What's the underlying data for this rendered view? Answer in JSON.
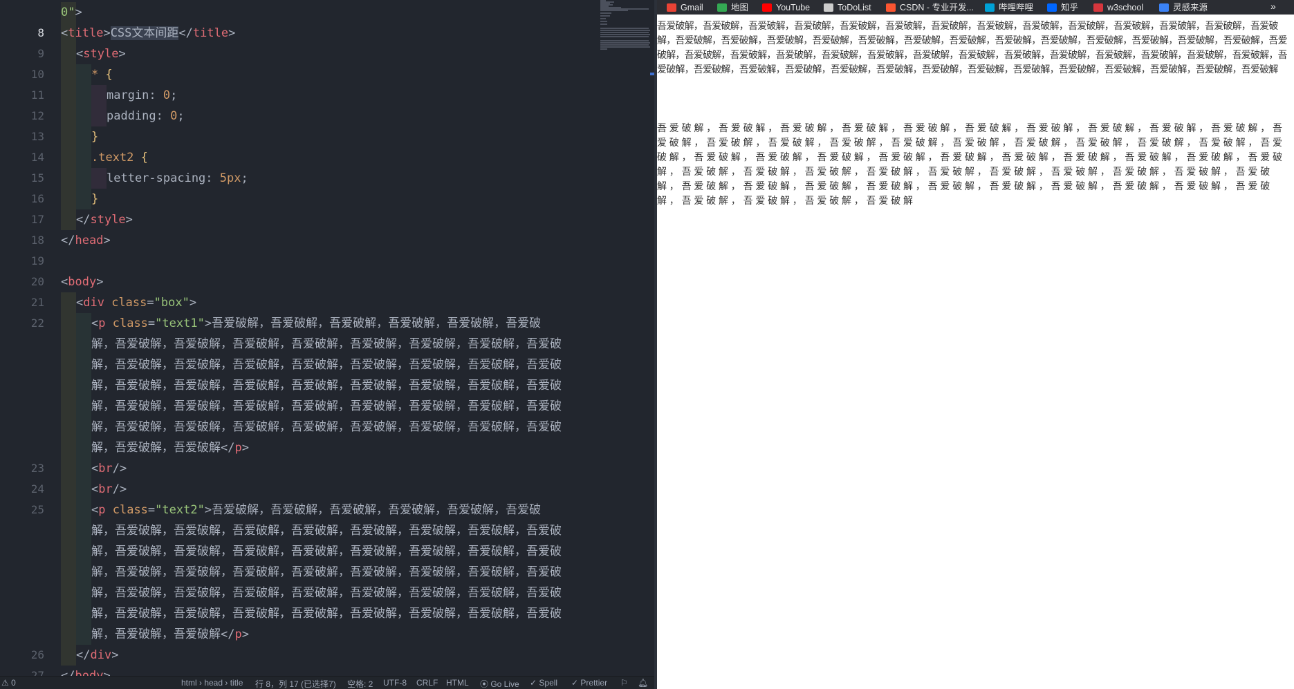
{
  "editor": {
    "lines": [
      {
        "num": "",
        "tokens": [
          [
            "str",
            "0\""
          ],
          [
            "br",
            ">"
          ]
        ]
      },
      {
        "num": "8",
        "active": true,
        "tokens": [
          [
            "br",
            "<"
          ],
          [
            "tag",
            "title"
          ],
          [
            "br",
            ">"
          ],
          [
            "hl",
            "CSS文本间距"
          ],
          [
            "br",
            "</"
          ],
          [
            "tag",
            "title"
          ],
          [
            "br",
            ">"
          ]
        ]
      },
      {
        "num": "9",
        "tokens": [
          [
            "br",
            "<"
          ],
          [
            "tag",
            "style"
          ],
          [
            "br",
            ">"
          ]
        ]
      },
      {
        "num": "10",
        "tokens": [
          [
            "sel",
            "* "
          ],
          [
            "brace",
            "{"
          ]
        ]
      },
      {
        "num": "11",
        "tokens": [
          [
            "prop",
            "margin: "
          ],
          [
            "num",
            "0"
          ],
          [
            "prop",
            ";"
          ]
        ]
      },
      {
        "num": "12",
        "tokens": [
          [
            "prop",
            "padding: "
          ],
          [
            "num",
            "0"
          ],
          [
            "prop",
            ";"
          ]
        ]
      },
      {
        "num": "13",
        "tokens": [
          [
            "brace",
            "}"
          ]
        ]
      },
      {
        "num": "14",
        "tokens": [
          [
            "sel",
            ".text2 "
          ],
          [
            "brace",
            "{"
          ]
        ]
      },
      {
        "num": "15",
        "tokens": [
          [
            "prop",
            "letter-spacing: "
          ],
          [
            "num",
            "5px"
          ],
          [
            "prop",
            ";"
          ]
        ]
      },
      {
        "num": "16",
        "tokens": [
          [
            "brace",
            "}"
          ]
        ]
      },
      {
        "num": "17",
        "tokens": [
          [
            "br",
            "</"
          ],
          [
            "tag",
            "style"
          ],
          [
            "br",
            ">"
          ]
        ]
      },
      {
        "num": "18",
        "tokens": [
          [
            "br",
            "</"
          ],
          [
            "tag",
            "head"
          ],
          [
            "br",
            ">"
          ]
        ]
      },
      {
        "num": "19",
        "tokens": []
      },
      {
        "num": "20",
        "tokens": [
          [
            "br",
            "<"
          ],
          [
            "tag",
            "body"
          ],
          [
            "br",
            ">"
          ]
        ]
      },
      {
        "num": "21",
        "tokens": [
          [
            "br",
            "<"
          ],
          [
            "tag",
            "div "
          ],
          [
            "attr",
            "class"
          ],
          [
            "br",
            "="
          ],
          [
            "str",
            "\"box\""
          ],
          [
            "br",
            ">"
          ]
        ]
      },
      {
        "num": "22",
        "tokens": [
          [
            "br",
            "<"
          ],
          [
            "tag",
            "p "
          ],
          [
            "attr",
            "class"
          ],
          [
            "br",
            "="
          ],
          [
            "str",
            "\"text1\""
          ],
          [
            "br",
            ">"
          ],
          [
            "text",
            "吾爱破解，吾爱破解，吾爱破解，吾爱破解，吾爱破解，吾爱破"
          ]
        ]
      },
      {
        "num": "",
        "tokens": [
          [
            "text",
            "解，吾爱破解，吾爱破解，吾爱破解，吾爱破解，吾爱破解，吾爱破解，吾爱破解，吾爱破"
          ]
        ]
      },
      {
        "num": "",
        "tokens": [
          [
            "text",
            "解，吾爱破解，吾爱破解，吾爱破解，吾爱破解，吾爱破解，吾爱破解，吾爱破解，吾爱破"
          ]
        ]
      },
      {
        "num": "",
        "tokens": [
          [
            "text",
            "解，吾爱破解，吾爱破解，吾爱破解，吾爱破解，吾爱破解，吾爱破解，吾爱破解，吾爱破"
          ]
        ]
      },
      {
        "num": "",
        "tokens": [
          [
            "text",
            "解，吾爱破解，吾爱破解，吾爱破解，吾爱破解，吾爱破解，吾爱破解，吾爱破解，吾爱破"
          ]
        ]
      },
      {
        "num": "",
        "tokens": [
          [
            "text",
            "解，吾爱破解，吾爱破解，吾爱破解，吾爱破解，吾爱破解，吾爱破解，吾爱破解，吾爱破"
          ]
        ]
      },
      {
        "num": "",
        "tokens": [
          [
            "text",
            "解，吾爱破解，吾爱破解"
          ],
          [
            "br",
            "</"
          ],
          [
            "tag",
            "p"
          ],
          [
            "br",
            ">"
          ]
        ]
      },
      {
        "num": "23",
        "tokens": [
          [
            "br",
            "<"
          ],
          [
            "tag",
            "br"
          ],
          [
            "br",
            "/>"
          ]
        ]
      },
      {
        "num": "24",
        "tokens": [
          [
            "br",
            "<"
          ],
          [
            "tag",
            "br"
          ],
          [
            "br",
            "/>"
          ]
        ]
      },
      {
        "num": "25",
        "tokens": [
          [
            "br",
            "<"
          ],
          [
            "tag",
            "p "
          ],
          [
            "attr",
            "class"
          ],
          [
            "br",
            "="
          ],
          [
            "str",
            "\"text2\""
          ],
          [
            "br",
            ">"
          ],
          [
            "text",
            "吾爱破解，吾爱破解，吾爱破解，吾爱破解，吾爱破解，吾爱破"
          ]
        ]
      },
      {
        "num": "",
        "tokens": [
          [
            "text",
            "解，吾爱破解，吾爱破解，吾爱破解，吾爱破解，吾爱破解，吾爱破解，吾爱破解，吾爱破"
          ]
        ]
      },
      {
        "num": "",
        "tokens": [
          [
            "text",
            "解，吾爱破解，吾爱破解，吾爱破解，吾爱破解，吾爱破解，吾爱破解，吾爱破解，吾爱破"
          ]
        ]
      },
      {
        "num": "",
        "tokens": [
          [
            "text",
            "解，吾爱破解，吾爱破解，吾爱破解，吾爱破解，吾爱破解，吾爱破解，吾爱破解，吾爱破"
          ]
        ]
      },
      {
        "num": "",
        "tokens": [
          [
            "text",
            "解，吾爱破解，吾爱破解，吾爱破解，吾爱破解，吾爱破解，吾爱破解，吾爱破解，吾爱破"
          ]
        ]
      },
      {
        "num": "",
        "tokens": [
          [
            "text",
            "解，吾爱破解，吾爱破解，吾爱破解，吾爱破解，吾爱破解，吾爱破解，吾爱破解，吾爱破"
          ]
        ]
      },
      {
        "num": "",
        "tokens": [
          [
            "text",
            "解，吾爱破解，吾爱破解"
          ],
          [
            "br",
            "</"
          ],
          [
            "tag",
            "p"
          ],
          [
            "br",
            ">"
          ]
        ]
      },
      {
        "num": "26",
        "tokens": [
          [
            "br",
            "</"
          ],
          [
            "tag",
            "div"
          ],
          [
            "br",
            ">"
          ]
        ]
      },
      {
        "num": "27",
        "tokens": [
          [
            "br",
            "</"
          ],
          [
            "tag",
            "body"
          ],
          [
            "br",
            ">"
          ]
        ]
      }
    ]
  },
  "statusbar": {
    "problems": "⚠ 0",
    "breadcrumb": "html › head › title",
    "cursor": "行 8，列 17 (已选择7)",
    "indent": "空格: 2",
    "encoding": "UTF-8",
    "eol": "CRLF",
    "language": "HTML",
    "golive": "Go Live",
    "spell": "Spell",
    "prettier": "Prettier"
  },
  "bookmarks": [
    {
      "label": "Gmail",
      "icon": "gmail-icon",
      "color": "#ea4335"
    },
    {
      "label": "地图",
      "icon": "maps-icon",
      "color": "#34a853"
    },
    {
      "label": "YouTube",
      "icon": "youtube-icon",
      "color": "#ff0000"
    },
    {
      "label": "ToDoList",
      "icon": "todolist-icon",
      "color": "#cccccc"
    },
    {
      "label": "CSDN - 专业开发...",
      "icon": "csdn-icon",
      "color": "#fc5531"
    },
    {
      "label": "哔哩哔哩",
      "icon": "bilibili-icon",
      "color": "#00a1d6"
    },
    {
      "label": "知乎",
      "icon": "zhihu-icon",
      "color": "#0066ff"
    },
    {
      "label": "w3school",
      "icon": "w3school-icon",
      "color": "#d6363d"
    },
    {
      "label": "灵感来源",
      "icon": "bookmark-icon",
      "color": "#3b82f6"
    }
  ],
  "bookmarks_more": "»",
  "page": {
    "text1": "吾爱破解，吾爱破解，吾爱破解，吾爱破解，吾爱破解，吾爱破解，吾爱破解，吾爱破解，吾爱破解，吾爱破解，吾爱破解，吾爱破解，吾爱破解，吾爱破解，吾爱破解，吾爱破解，吾爱破解，吾爱破解，吾爱破解，吾爱破解，吾爱破解，吾爱破解，吾爱破解，吾爱破解，吾爱破解，吾爱破解，吾爱破解，吾爱破解，吾爱破解，吾爱破解，吾爱破解，吾爱破解，吾爱破解，吾爱破解，吾爱破解，吾爱破解，吾爱破解，吾爱破解，吾爱破解，吾爱破解，吾爱破解，吾爱破解，吾爱破解，吾爱破解，吾爱破解，吾爱破解，吾爱破解，吾爱破解，吾爱破解，吾爱破解，吾爱破解，吾爱破解，吾爱破解，吾爱破解，吾爱破解",
    "text2": "吾爱破解，吾爱破解，吾爱破解，吾爱破解，吾爱破解，吾爱破解，吾爱破解，吾爱破解，吾爱破解，吾爱破解，吾爱破解，吾爱破解，吾爱破解，吾爱破解，吾爱破解，吾爱破解，吾爱破解，吾爱破解，吾爱破解，吾爱破解，吾爱破解，吾爱破解，吾爱破解，吾爱破解，吾爱破解，吾爱破解，吾爱破解，吾爱破解，吾爱破解，吾爱破解，吾爱破解，吾爱破解，吾爱破解，吾爱破解，吾爱破解，吾爱破解，吾爱破解，吾爱破解，吾爱破解，吾爱破解，吾爱破解，吾爱破解，吾爱破解，吾爱破解，吾爱破解，吾爱破解，吾爱破解，吾爱破解，吾爱破解，吾爱破解，吾爱破解，吾爱破解，吾爱破解，吾爱破解，吾爱破解"
  },
  "colors": {
    "editor_bg": "#22262e",
    "page_bg": "#ffffff",
    "tag": "#e06c75",
    "string": "#98c379",
    "number": "#d19a66"
  }
}
